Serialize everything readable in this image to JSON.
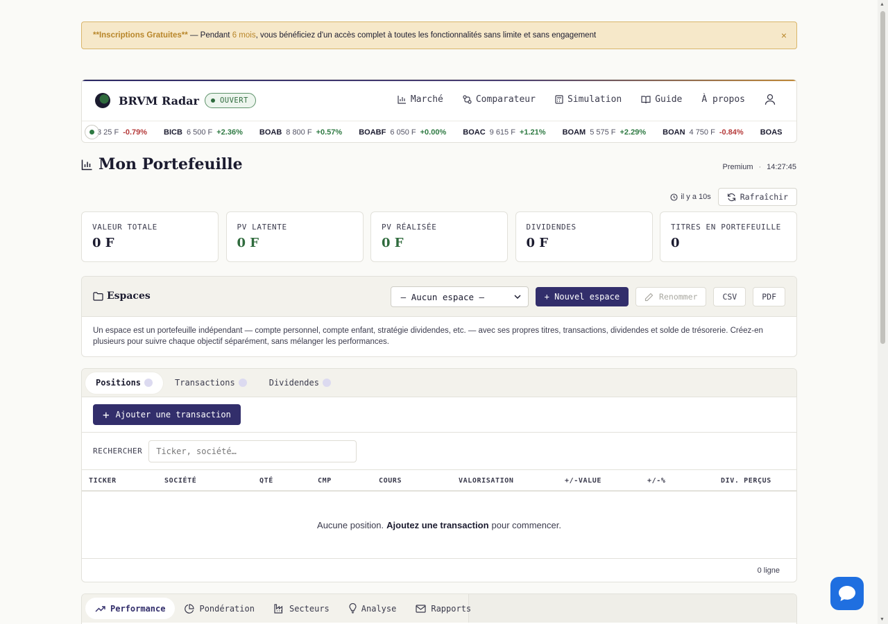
{
  "banner": {
    "bold": "**Inscriptions Gratuites**",
    "pre": " — Pendant ",
    "highlight": "6 mois",
    "post": ", vous bénéficiez d'un accès complet à toutes les fonctionnalités sans limite et sans engagement",
    "close": "×"
  },
  "header": {
    "brand": "BRVM Radar",
    "status": "OUVERT",
    "nav": [
      "Marché",
      "Comparateur",
      "Simulation",
      "Guide",
      "À propos"
    ]
  },
  "ticker": [
    {
      "sym": "",
      "price": "3 25 F",
      "chg": "-0.79%",
      "dir": "down"
    },
    {
      "sym": "BICB",
      "price": "6 500 F",
      "chg": "+2.36%",
      "dir": "up"
    },
    {
      "sym": "BOAB",
      "price": "8 800 F",
      "chg": "+0.57%",
      "dir": "up"
    },
    {
      "sym": "BOABF",
      "price": "6 050 F",
      "chg": "+0.00%",
      "dir": "up"
    },
    {
      "sym": "BOAC",
      "price": "9 615 F",
      "chg": "+1.21%",
      "dir": "up"
    },
    {
      "sym": "BOAM",
      "price": "5 575 F",
      "chg": "+2.29%",
      "dir": "up"
    },
    {
      "sym": "BOAN",
      "price": "4 750 F",
      "chg": "-0.84%",
      "dir": "down"
    },
    {
      "sym": "BOAS",
      "price": "",
      "chg": "",
      "dir": "up"
    }
  ],
  "page": {
    "title": "Mon Portefeuille",
    "plan": "Premium",
    "sep": "·",
    "time": "14:27:45",
    "ago": "il y a 10s",
    "refresh": "Rafraîchir"
  },
  "kpis": [
    {
      "label": "VALEUR TOTALE",
      "value": "0 F",
      "tone": "dark"
    },
    {
      "label": "PV LATENTE",
      "value": "0 F",
      "tone": "green"
    },
    {
      "label": "PV RÉALISÉE",
      "value": "0 F",
      "tone": "green"
    },
    {
      "label": "DIVIDENDES",
      "value": "0 F",
      "tone": "dark"
    },
    {
      "label": "TITRES EN PORTEFEUILLE",
      "value": "0",
      "tone": "dark"
    }
  ],
  "espaces": {
    "title": "Espaces",
    "select": "— Aucun espace —",
    "new": "+ Nouvel espace",
    "rename": "Renommer",
    "csv": "CSV",
    "pdf": "PDF",
    "desc": "Un espace est un portefeuille indépendant — compte personnel, compte enfant, stratégie dividendes, etc. — avec ses propres titres, transactions, dividendes et solde de trésorerie. Créez-en plusieurs pour suivre chaque objectif séparément, sans mélanger les performances."
  },
  "positions": {
    "tabs": [
      "Positions",
      "Transactions",
      "Dividendes"
    ],
    "add": "Ajouter une transaction",
    "search_label": "RECHERCHER",
    "search_placeholder": "Ticker, société…",
    "columns": [
      "TICKER",
      "SOCIÉTÉ",
      "QTÉ",
      "CMP",
      "COURS",
      "VALORISATION",
      "+/-VALUE",
      "+/-%",
      "DIV. PERÇUS"
    ],
    "empty_pre": "Aucune position.",
    "empty_link": "Ajoutez une transaction",
    "empty_post": "pour commencer.",
    "count": "0 ligne"
  },
  "bottom_tabs": [
    "Performance",
    "Pondération",
    "Secteurs",
    "Analyse",
    "Rapports"
  ],
  "colors": {
    "accent": "#322e6b",
    "up": "#2f7a43",
    "down": "#b53a3a",
    "banner": "#f6e8c9",
    "chat": "#1f6fe0"
  }
}
